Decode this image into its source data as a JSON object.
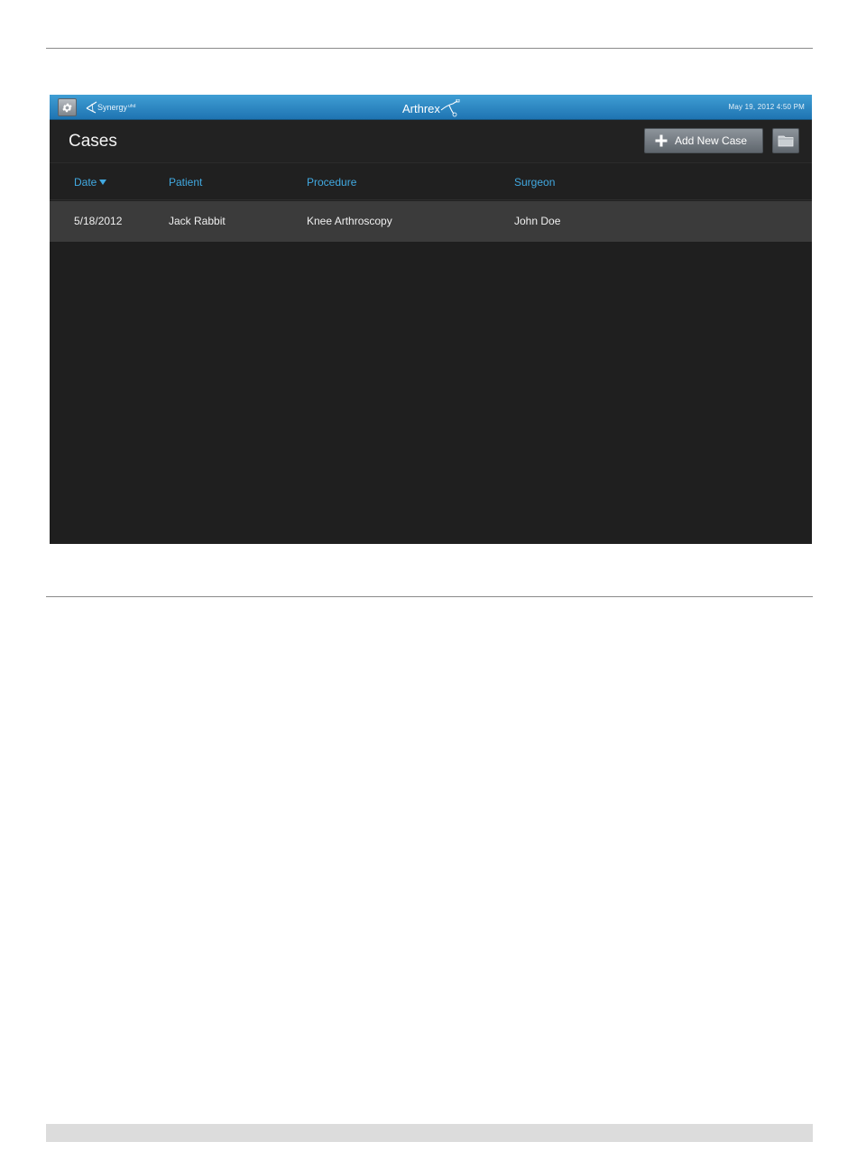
{
  "status_bar": {
    "app_logo": "Synergy",
    "app_logo_mark": "uhd",
    "brand": "Arthrex",
    "datetime": "May 19, 2012   4:50 PM",
    "icons": {
      "settings": "gear-icon",
      "app_logo": "synergy-logo-icon",
      "brand_mark": "arthrex-logo-icon"
    }
  },
  "title_bar": {
    "title": "Cases",
    "add_button_label": "Add New Case",
    "icons": {
      "add": "plus-icon",
      "folder": "folder-icon"
    }
  },
  "table": {
    "columns": [
      "Date",
      "Patient",
      "Procedure",
      "Surgeon"
    ],
    "sort_column": "Date",
    "sort_direction": "descending",
    "rows": [
      {
        "date": "5/18/2012",
        "patient": "Jack Rabbit",
        "procedure": "Knee Arthroscopy",
        "surgeon": "John Doe"
      }
    ]
  },
  "colors": {
    "status_bar": "#2e8bc8",
    "header_text": "#41a9e1",
    "background": "#202020",
    "selected_row": "#3b3b3b",
    "button": "#767d84"
  }
}
